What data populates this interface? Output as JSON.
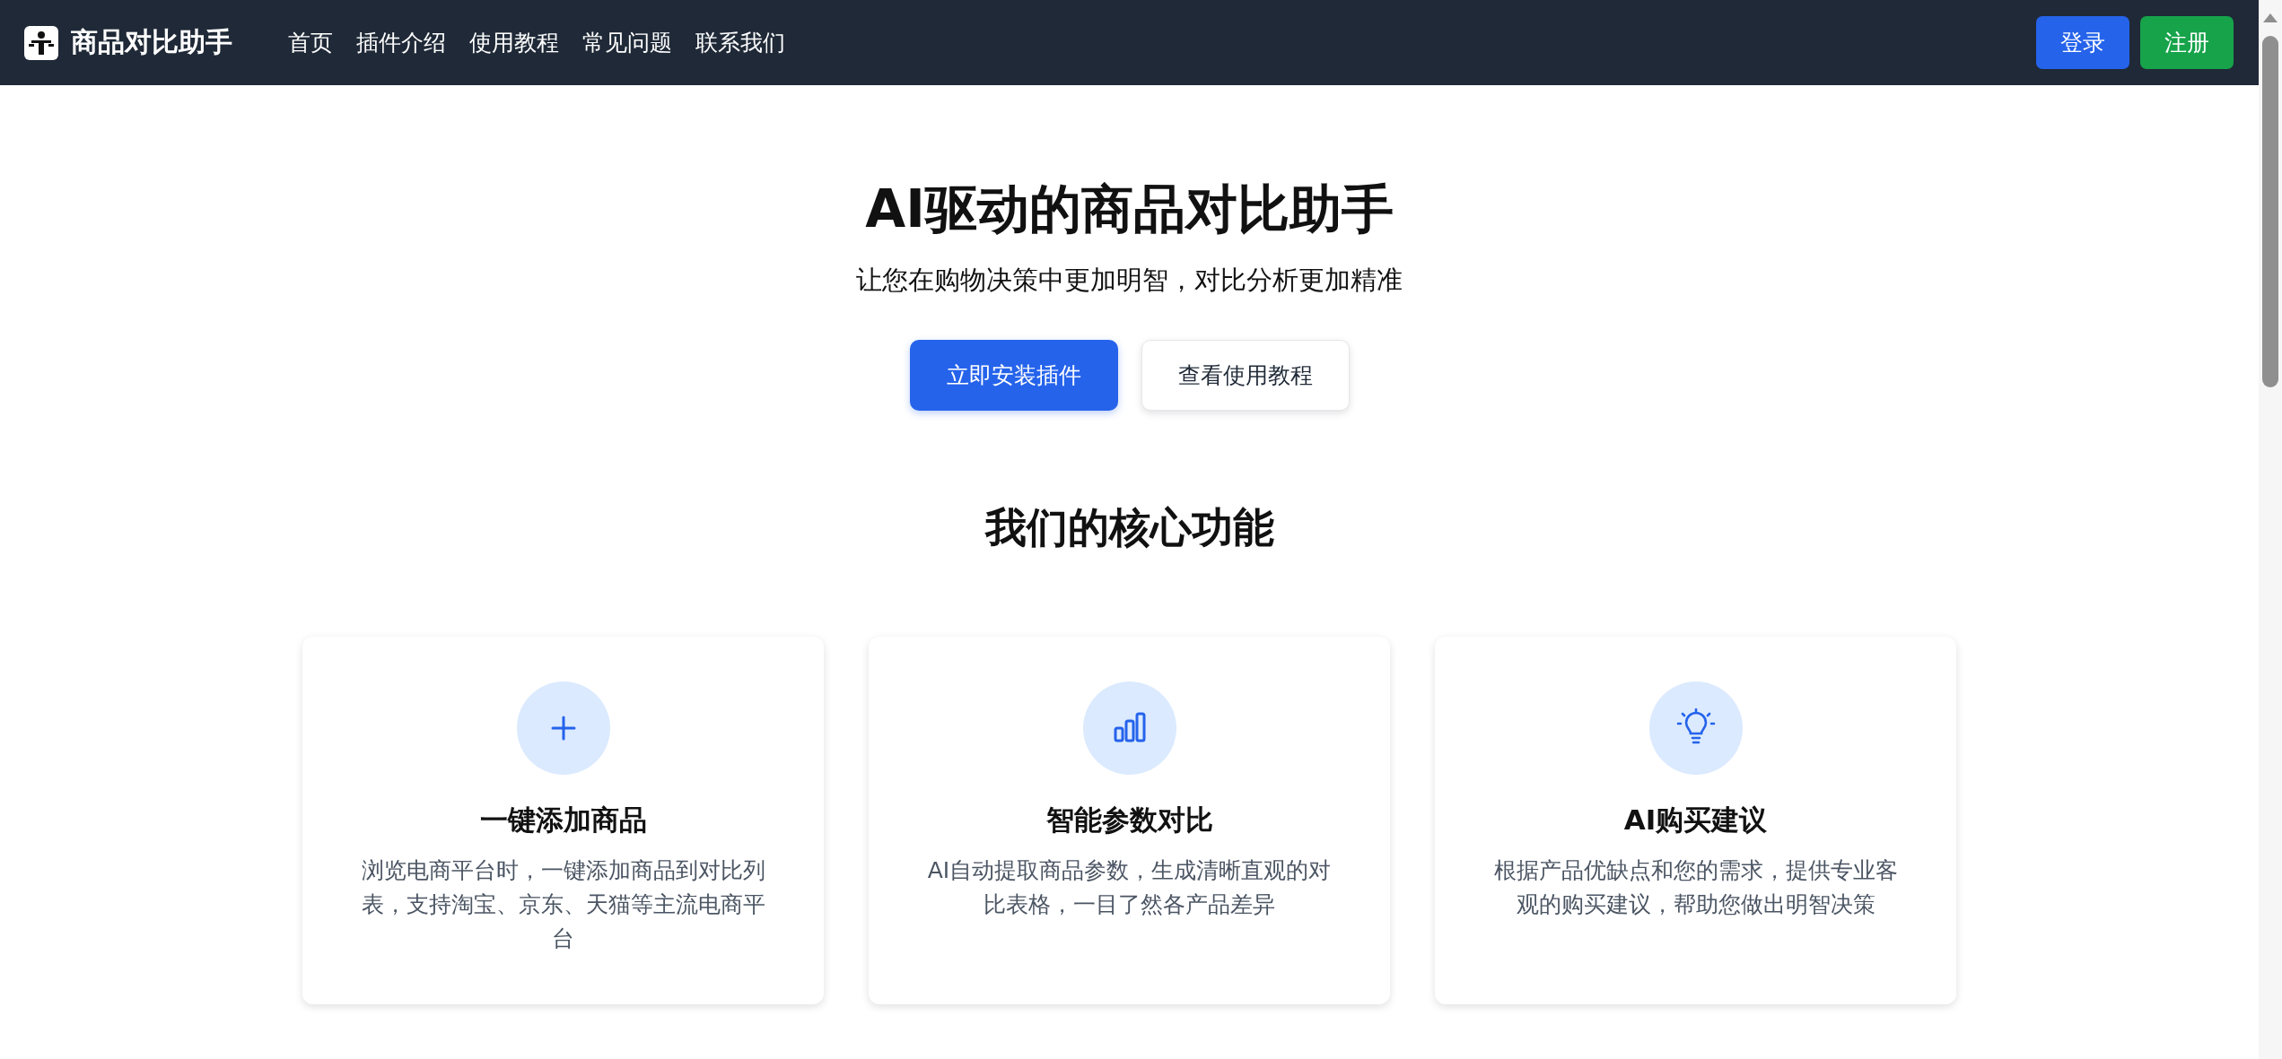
{
  "navbar": {
    "brand": "商品对比助手",
    "links": [
      {
        "label": "首页"
      },
      {
        "label": "插件介绍"
      },
      {
        "label": "使用教程"
      },
      {
        "label": "常见问题"
      },
      {
        "label": "联系我们"
      }
    ],
    "buttons": [
      {
        "label": "登录",
        "kind": "primary"
      },
      {
        "label": "注册",
        "kind": "success"
      }
    ]
  },
  "hero": {
    "title": "AI驱动的商品对比助手",
    "subtitle": "让您在购物决策中更加明智，对比分析更加精准",
    "buttons": [
      {
        "label": "立即安装插件",
        "kind": "primary"
      },
      {
        "label": "查看使用教程",
        "kind": "outline"
      }
    ]
  },
  "features": {
    "title": "我们的核心功能",
    "cards": [
      {
        "kind": "plus",
        "title": "一键添加商品",
        "description": "浏览电商平台时，一键添加商品到对比列表，支持淘宝、京东、天猫等主流电商平台"
      },
      {
        "kind": "chart",
        "title": "智能参数对比",
        "description": "AI自动提取商品参数，生成清晰直观的对比表格，一目了然各产品差异"
      },
      {
        "kind": "bulb",
        "title": "AI购买建议",
        "description": "根据产品优缺点和您的需求，提供专业客观的购买建议，帮助您做出明智决策"
      }
    ]
  }
}
